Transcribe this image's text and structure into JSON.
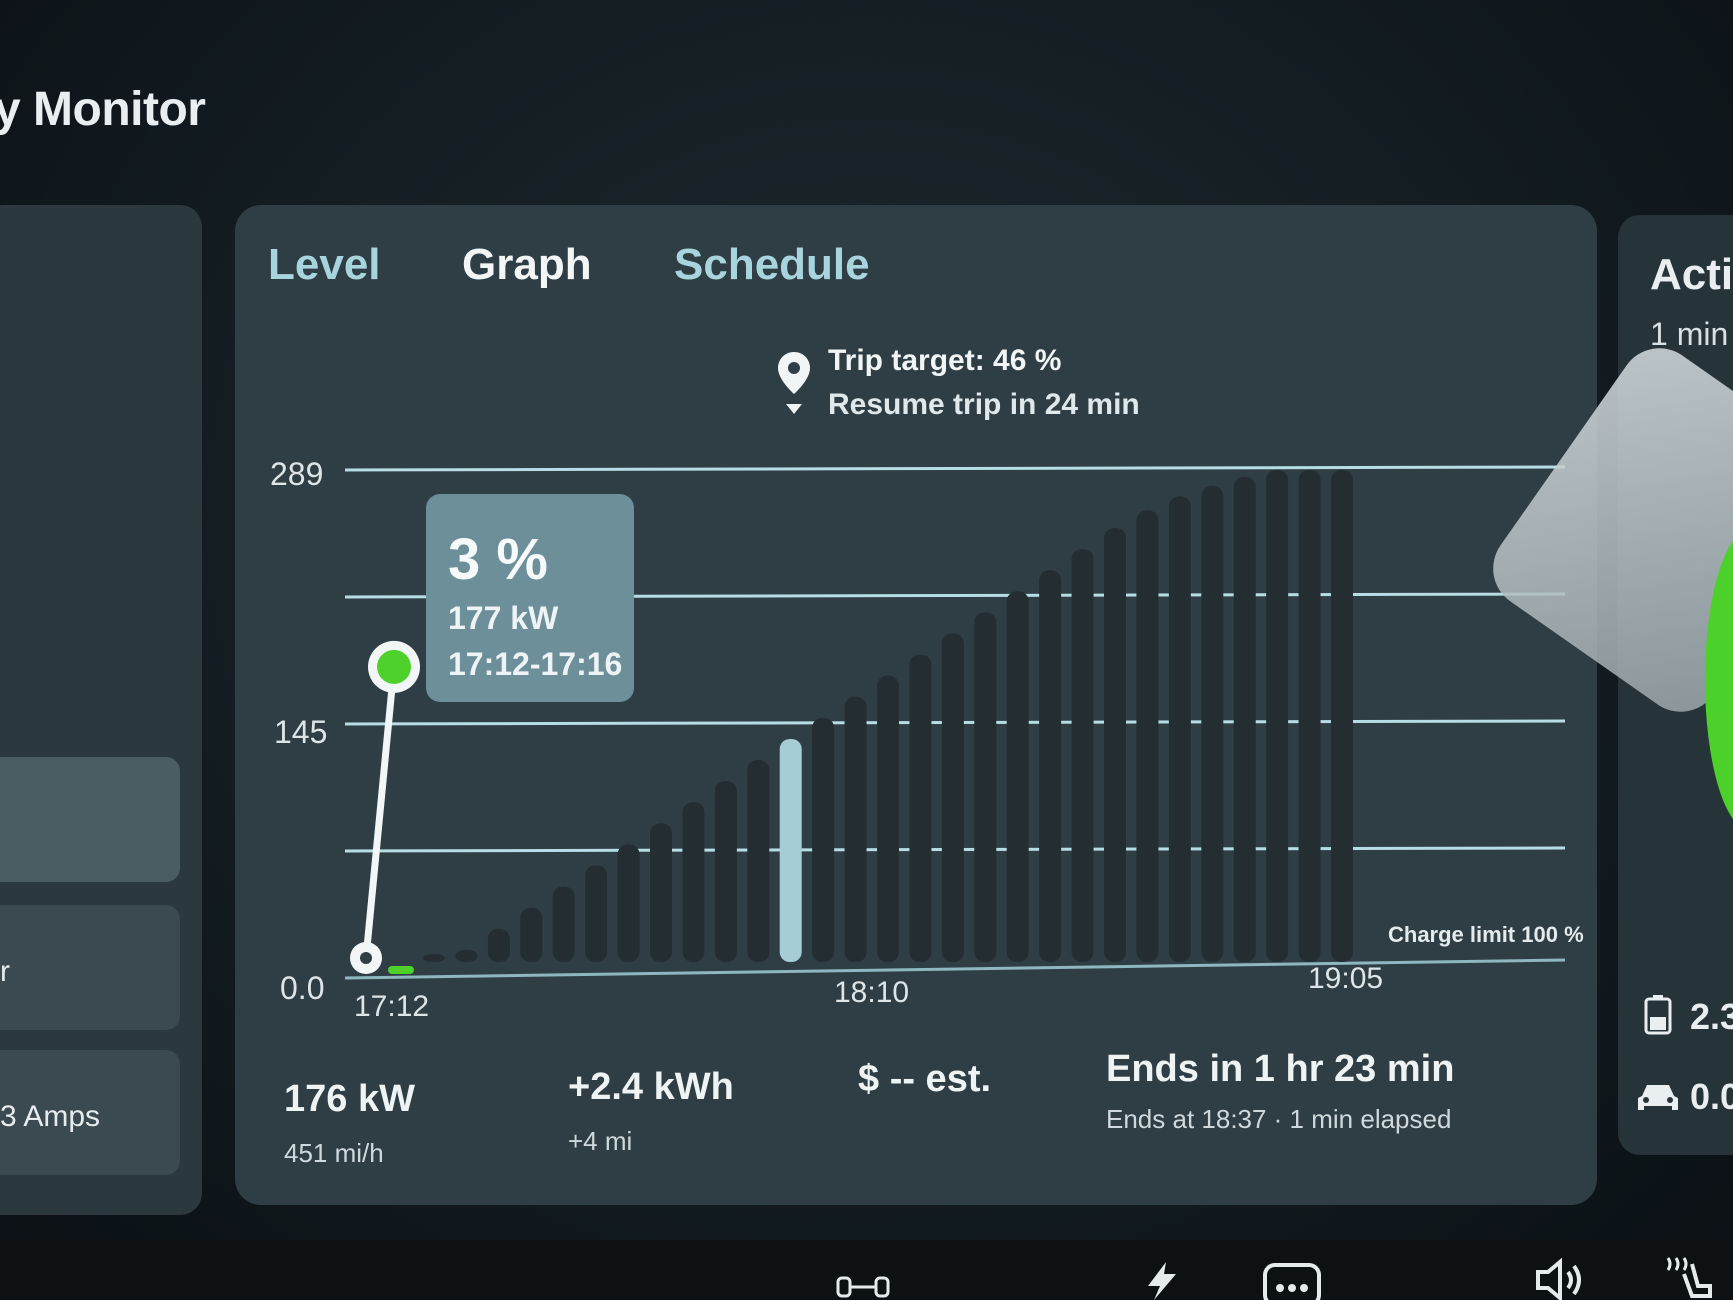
{
  "header": {
    "title": "y Monitor"
  },
  "left_panel": {
    "card2_text": "r",
    "card3_text": "3 Amps"
  },
  "tabs": [
    {
      "label": "Level",
      "active": false
    },
    {
      "label": "Graph",
      "active": true
    },
    {
      "label": "Schedule",
      "active": false
    }
  ],
  "trip": {
    "target": "Trip target: 46 %",
    "resume": "Resume trip in 24 min"
  },
  "tooltip": {
    "percent": "3 %",
    "power": "177 kW",
    "time_range": "17:12-17:16"
  },
  "chart_data": {
    "type": "bar",
    "y_ticks": [
      "289",
      "145",
      "0.0"
    ],
    "ylim": [
      0,
      289
    ],
    "x_ticks": [
      "17:12",
      "18:10",
      "19:05"
    ],
    "charge_limit_label": "Charge limit 100 %",
    "bar_values": [
      6,
      16,
      28,
      40,
      52,
      64,
      76,
      88,
      100,
      112,
      124,
      136,
      148,
      160,
      172,
      184,
      196,
      208,
      220,
      232,
      244,
      256,
      266,
      274,
      280,
      285,
      289,
      289,
      289
    ],
    "highlight_index": 11,
    "line_point": 177,
    "colors": {
      "bar": "#242d31",
      "highlight": "#a6ccd6",
      "line": "#f2f6f7",
      "point": "#4ed12b",
      "grid": "#b7dde4"
    }
  },
  "stats": {
    "power": "176 kW",
    "rate": "451 mi/h",
    "energy": "+2.4 kWh",
    "range": "+4 mi",
    "cost": "$ -- est.",
    "ends_in": "Ends in 1 hr 23 min",
    "ends_at": "Ends at 18:37 · 1 min elapsed"
  },
  "right_panel": {
    "title": "Activ",
    "subtitle": "1 min",
    "value1": "2.3",
    "value2": "0.0",
    "icon1": "battery-icon",
    "icon2": "car-icon"
  },
  "dock_icons": [
    "sensor-icon",
    "bolt-icon",
    "more-icon",
    "volume-icon",
    "seat-heat-icon"
  ]
}
